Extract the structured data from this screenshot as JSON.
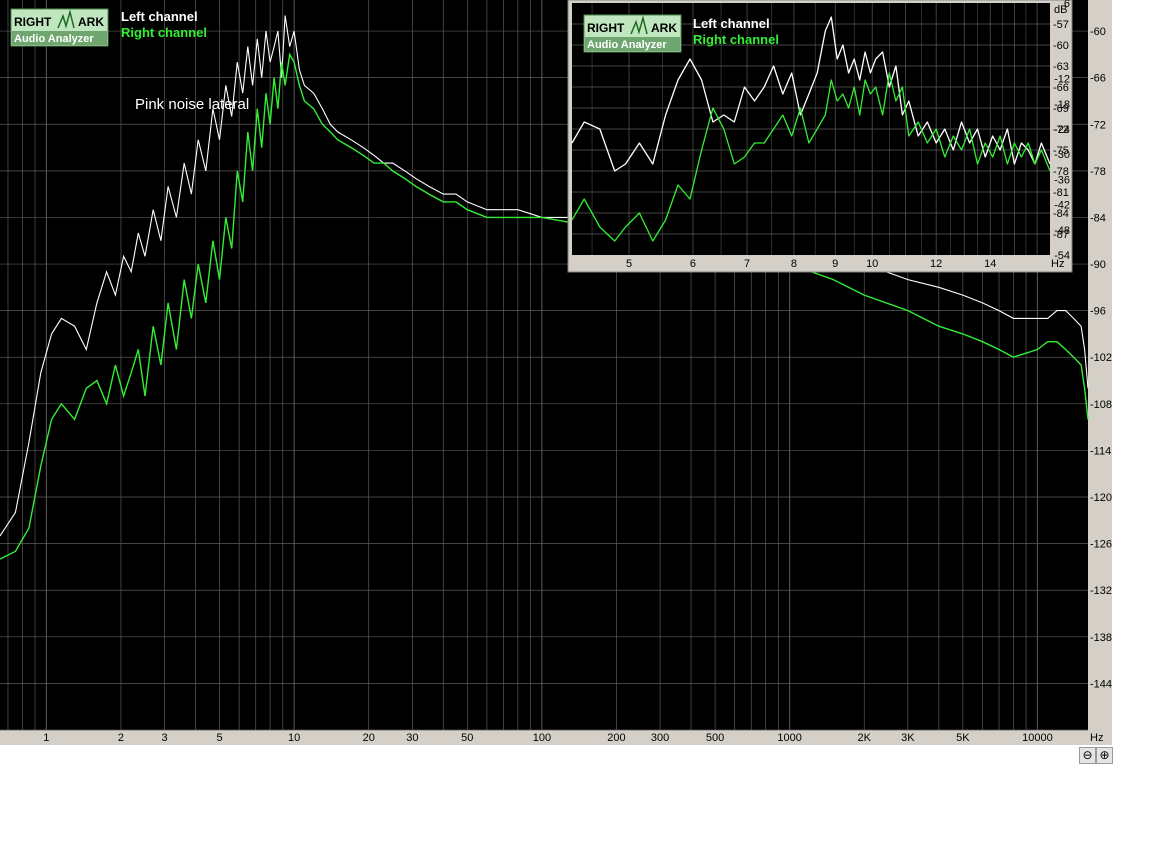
{
  "logo": {
    "line1": "RIGHT",
    "line2": "ARK",
    "line3": "Audio Analyzer"
  },
  "colors": {
    "left": "#ffffff",
    "right": "#33ee33",
    "background": "#000000",
    "grid": "#5a5a5a",
    "panel": "#d4d0c8"
  },
  "zoom_icons": [
    "zoom-out-icon",
    "zoom-in-icon"
  ],
  "chart_data": [
    {
      "type": "line",
      "annotation": "Pink noise lateral",
      "xunit": "Hz",
      "yunit": "",
      "xscale": "log",
      "xlim": [
        0.65,
        16000
      ],
      "ylim": [
        -150,
        -56
      ],
      "x_ticks": [
        {
          "v": 1,
          "t": "1"
        },
        {
          "v": 2,
          "t": "2"
        },
        {
          "v": 3,
          "t": "3"
        },
        {
          "v": 5,
          "t": "5"
        },
        {
          "v": 10,
          "t": "10"
        },
        {
          "v": 20,
          "t": "20"
        },
        {
          "v": 30,
          "t": "30"
        },
        {
          "v": 50,
          "t": "50"
        },
        {
          "v": 100,
          "t": "100"
        },
        {
          "v": 200,
          "t": "200"
        },
        {
          "v": 300,
          "t": "300"
        },
        {
          "v": 500,
          "t": "500"
        },
        {
          "v": 1000,
          "t": "1000"
        },
        {
          "v": 2000,
          "t": "2K"
        },
        {
          "v": 3000,
          "t": "3K"
        },
        {
          "v": 5000,
          "t": "5K"
        },
        {
          "v": 10000,
          "t": "10000"
        }
      ],
      "y_ticks": [
        -60,
        -66,
        -72,
        -78,
        -84,
        -90,
        -96,
        -102,
        -108,
        -114,
        -120,
        -126,
        -132,
        -138,
        -144
      ],
      "grid": true,
      "legend_position": "top-left",
      "series": [
        {
          "name": "Left channel",
          "x": [
            0.65,
            0.75,
            0.85,
            0.95,
            1.05,
            1.15,
            1.3,
            1.45,
            1.6,
            1.75,
            1.9,
            2.05,
            2.2,
            2.35,
            2.5,
            2.7,
            2.9,
            3.1,
            3.35,
            3.6,
            3.85,
            4.1,
            4.4,
            4.7,
            5.0,
            5.3,
            5.6,
            5.9,
            6.2,
            6.5,
            6.8,
            7.1,
            7.4,
            7.7,
            8.0,
            8.3,
            8.6,
            8.9,
            9.2,
            9.6,
            10.0,
            10.5,
            11,
            12,
            13,
            14,
            15,
            17,
            19,
            21,
            23,
            25,
            28,
            31,
            35,
            40,
            45,
            50,
            60,
            80,
            100,
            150,
            200,
            300,
            500,
            700,
            1000,
            1500,
            2000,
            3000,
            4000,
            5000,
            6000,
            7000,
            8000,
            10000,
            11000,
            12000,
            13000,
            14000,
            15000,
            15500,
            16000
          ],
          "y": [
            -125,
            -122,
            -113,
            -104,
            -99,
            -97,
            -98,
            -101,
            -95,
            -91,
            -94,
            -89,
            -91,
            -86,
            -89,
            -83,
            -87,
            -80,
            -84,
            -77,
            -81,
            -74,
            -78,
            -70,
            -74,
            -67,
            -71,
            -64,
            -68,
            -62,
            -67,
            -61,
            -66,
            -60,
            -64,
            -62,
            -60,
            -66,
            -58,
            -62,
            -60,
            -65,
            -67,
            -68,
            -70,
            -72,
            -73,
            -74,
            -75,
            -76,
            -77,
            -77,
            -78,
            -79,
            -80,
            -81,
            -81,
            -82,
            -83,
            -83,
            -84,
            -84,
            -85,
            -85,
            -86,
            -87,
            -88,
            -89,
            -90,
            -92,
            -93,
            -94,
            -95,
            -96,
            -97,
            -97,
            -97,
            -96,
            -96,
            -97,
            -98,
            -101,
            -106
          ]
        },
        {
          "name": "Right channel",
          "x": [
            0.65,
            0.75,
            0.85,
            0.95,
            1.05,
            1.15,
            1.3,
            1.45,
            1.6,
            1.75,
            1.9,
            2.05,
            2.2,
            2.35,
            2.5,
            2.7,
            2.9,
            3.1,
            3.35,
            3.6,
            3.85,
            4.1,
            4.4,
            4.7,
            5.0,
            5.3,
            5.6,
            5.9,
            6.2,
            6.5,
            6.8,
            7.1,
            7.4,
            7.7,
            8.0,
            8.3,
            8.6,
            8.9,
            9.2,
            9.6,
            10.0,
            10.5,
            11,
            12,
            13,
            14,
            15,
            17,
            19,
            21,
            23,
            25,
            28,
            31,
            35,
            40,
            45,
            50,
            60,
            80,
            100,
            150,
            200,
            300,
            500,
            700,
            1000,
            1500,
            2000,
            3000,
            4000,
            5000,
            6000,
            7000,
            8000,
            10000,
            11000,
            12000,
            13000,
            14000,
            15000,
            15500,
            16000
          ],
          "y": [
            -128,
            -127,
            -124,
            -116,
            -110,
            -108,
            -110,
            -106,
            -105,
            -108,
            -103,
            -107,
            -104,
            -101,
            -107,
            -98,
            -103,
            -95,
            -101,
            -92,
            -97,
            -90,
            -95,
            -87,
            -92,
            -84,
            -88,
            -78,
            -82,
            -73,
            -78,
            -70,
            -75,
            -68,
            -72,
            -66,
            -70,
            -64,
            -67,
            -63,
            -64,
            -67,
            -69,
            -70,
            -72,
            -73,
            -74,
            -75,
            -76,
            -77,
            -77,
            -78,
            -79,
            -80,
            -81,
            -82,
            -82,
            -83,
            -84,
            -84,
            -84,
            -85,
            -86,
            -86,
            -88,
            -89,
            -90,
            -92,
            -94,
            -96,
            -98,
            -99,
            -100,
            -101,
            -102,
            -101,
            -100,
            -100,
            -101,
            -102,
            -103,
            -106,
            -110
          ]
        }
      ]
    },
    {
      "type": "line",
      "xunit": "Hz",
      "yunit": "dB",
      "xscale": "log",
      "xlim": [
        4.25,
        16.6
      ],
      "ylim": [
        -90,
        -54
      ],
      "ylim_right": [
        -54,
        6
      ],
      "x_ticks": [
        {
          "v": 5,
          "t": "5"
        },
        {
          "v": 6,
          "t": "6"
        },
        {
          "v": 7,
          "t": "7"
        },
        {
          "v": 8,
          "t": "8"
        },
        {
          "v": 9,
          "t": "9"
        },
        {
          "v": 10,
          "t": "10"
        },
        {
          "v": 12,
          "t": "12"
        },
        {
          "v": 14,
          "t": "14"
        }
      ],
      "y_ticks": [
        -57,
        -60,
        -63,
        -66,
        -69,
        -72,
        -75,
        -78,
        -81,
        -84,
        -87
      ],
      "y_ticks_right": [
        6,
        -12,
        -18,
        -24,
        -30,
        -36,
        -42,
        -48,
        -54
      ],
      "grid": true,
      "legend_position": "top-left",
      "series": [
        {
          "name": "Left channel",
          "x": [
            4.25,
            4.4,
            4.6,
            4.8,
            4.95,
            5.15,
            5.35,
            5.55,
            5.75,
            5.95,
            6.15,
            6.35,
            6.55,
            6.75,
            6.95,
            7.15,
            7.35,
            7.55,
            7.75,
            7.95,
            8.15,
            8.35,
            8.55,
            8.75,
            8.9,
            9.05,
            9.2,
            9.35,
            9.5,
            9.65,
            9.8,
            9.95,
            10.1,
            10.3,
            10.5,
            10.7,
            10.9,
            11.1,
            11.4,
            11.7,
            12.0,
            12.3,
            12.6,
            12.9,
            13.2,
            13.5,
            13.8,
            14.1,
            14.4,
            14.7,
            15.0,
            15.3,
            15.6,
            15.9,
            16.2,
            16.6
          ],
          "y": [
            -74,
            -71,
            -72,
            -78,
            -77,
            -74,
            -77,
            -70,
            -65,
            -62,
            -65,
            -71,
            -70,
            -71,
            -66,
            -68,
            -66,
            -63,
            -67,
            -64,
            -70,
            -67,
            -64,
            -58,
            -56,
            -62,
            -60,
            -64,
            -62,
            -65,
            -61,
            -64,
            -62,
            -61,
            -66,
            -63,
            -70,
            -68,
            -73,
            -71,
            -74,
            -72,
            -75,
            -71,
            -74,
            -72,
            -76,
            -73,
            -75,
            -72,
            -77,
            -74,
            -75,
            -77,
            -74,
            -77
          ]
        },
        {
          "name": "Right channel",
          "x": [
            4.25,
            4.4,
            4.6,
            4.8,
            4.95,
            5.15,
            5.35,
            5.55,
            5.75,
            5.95,
            6.15,
            6.35,
            6.55,
            6.75,
            6.95,
            7.15,
            7.35,
            7.55,
            7.75,
            7.95,
            8.15,
            8.35,
            8.55,
            8.75,
            8.9,
            9.05,
            9.2,
            9.35,
            9.5,
            9.65,
            9.8,
            9.95,
            10.1,
            10.3,
            10.5,
            10.7,
            10.9,
            11.1,
            11.4,
            11.7,
            12.0,
            12.3,
            12.6,
            12.9,
            13.2,
            13.5,
            13.8,
            14.1,
            14.4,
            14.7,
            15.0,
            15.3,
            15.6,
            15.9,
            16.2,
            16.6
          ],
          "y": [
            -85,
            -82,
            -86,
            -88,
            -86,
            -84,
            -88,
            -85,
            -80,
            -82,
            -75,
            -69,
            -72,
            -77,
            -76,
            -74,
            -74,
            -72,
            -70,
            -73,
            -69,
            -74,
            -72,
            -70,
            -65,
            -68,
            -67,
            -69,
            -66,
            -70,
            -65,
            -67,
            -66,
            -70,
            -64,
            -68,
            -66,
            -73,
            -71,
            -74,
            -72,
            -76,
            -73,
            -75,
            -72,
            -77,
            -74,
            -76,
            -73,
            -77,
            -74,
            -76,
            -74,
            -77,
            -75,
            -78
          ]
        }
      ]
    }
  ]
}
